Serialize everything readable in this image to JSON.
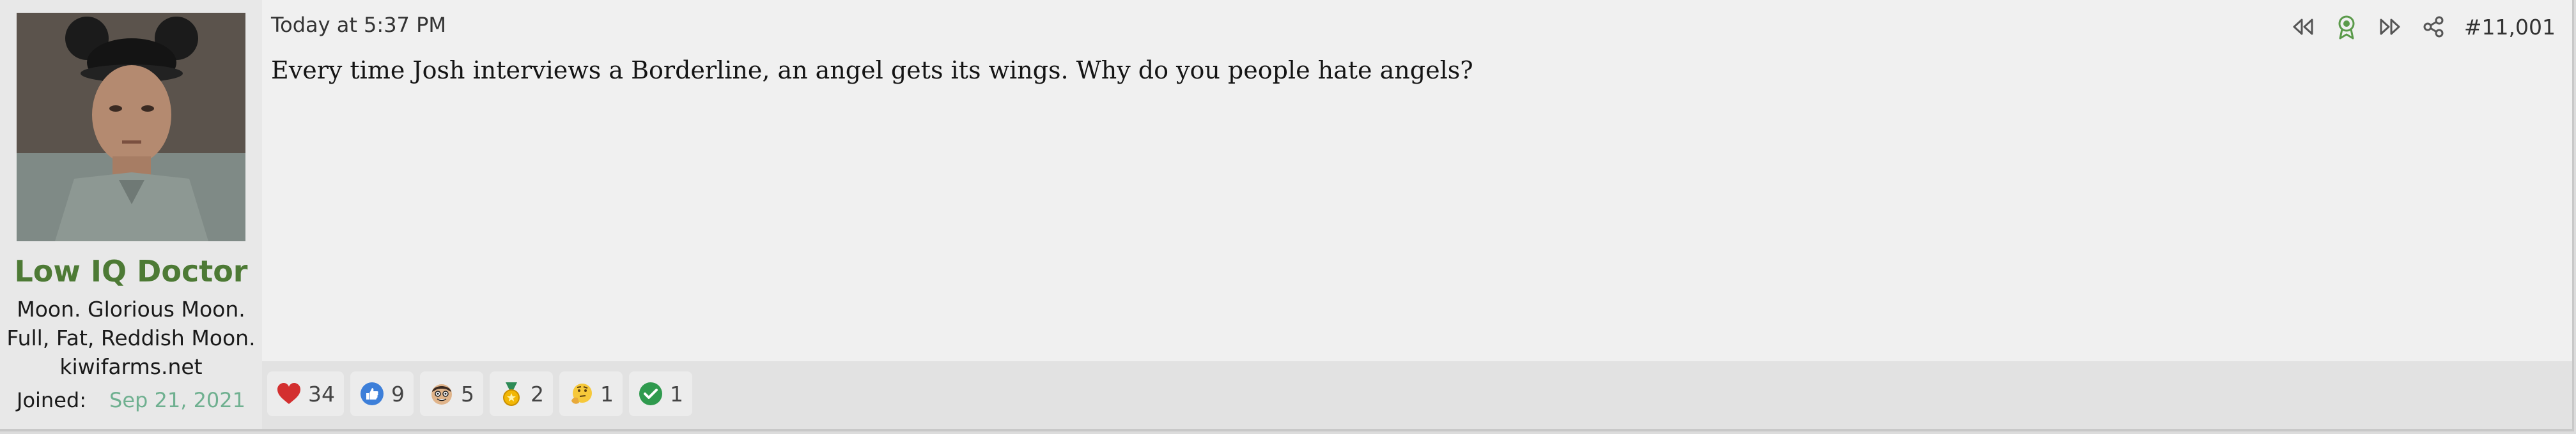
{
  "user": {
    "name": "Low IQ Doctor",
    "title_lines": [
      "Moon. Glorious Moon.",
      "Full, Fat, Reddish Moon.",
      "kiwifarms.net"
    ],
    "joined_label": "Joined:",
    "joined_value": "Sep 21, 2021"
  },
  "post": {
    "date": "Today at 5:37 PM",
    "number": "#11,001",
    "text": "Every time Josh interviews a Borderline, an angel gets its wings. Why do you people hate angels?"
  },
  "tools": [
    "rewind-icon",
    "award-icon",
    "fast-forward-icon",
    "share-icon"
  ],
  "reactions": [
    {
      "icon": "heart-icon",
      "count": "34"
    },
    {
      "icon": "thumbs-up-icon",
      "count": "9"
    },
    {
      "icon": "face-icon",
      "count": "5"
    },
    {
      "icon": "medal-icon",
      "count": "2"
    },
    {
      "icon": "thinking-icon",
      "count": "1"
    },
    {
      "icon": "check-icon",
      "count": "1"
    }
  ],
  "colors": {
    "username": "#4d7a35",
    "joined": "#6fb090",
    "award": "#5a9a4a"
  }
}
